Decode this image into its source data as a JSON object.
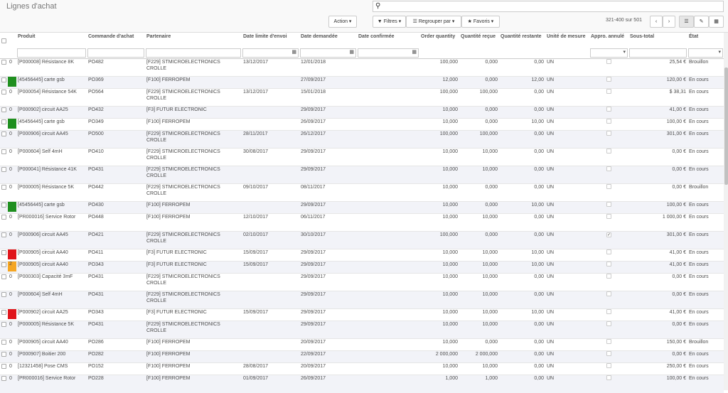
{
  "header": {
    "title": "Lignes d'achat",
    "search_value": ""
  },
  "toolbar": {
    "action": "Action ▾",
    "filters": "Filtres ▾",
    "group_by": "Regrouper par ▾",
    "favorites": "Favoris ▾"
  },
  "pager": {
    "text": "321-400 sur 501"
  },
  "columns": [
    "Produit",
    "Commande d'achat",
    "Partenaire",
    "Date limite d'envoi",
    "Date demandée",
    "Date confirmée",
    "Order quantity",
    "Quantité reçue",
    "Quantité restante",
    "Unité de mesure",
    "Appro. annulé",
    "Sous-total",
    "État"
  ],
  "colors": {
    "green": "#1f8f1f",
    "red": "#e0151b",
    "orange": "#f5a623"
  },
  "rows": [
    {
      "cnt": "0",
      "c": "",
      "p": "[P000008] Résistance 8K",
      "po": "PO482",
      "pa": "[F229] STMICROELECTRONICS CROLLE",
      "dl": "13/12/2017",
      "dd": "12/01/2018",
      "dc": "",
      "oq": "100,000",
      "qr": "0,000",
      "qrest": "0,00",
      "u": "UN",
      "a": false,
      "st": "25,54 €",
      "e": "Brouillon"
    },
    {
      "cnt": "",
      "c": "green",
      "p": "[45456445] carte gsb",
      "po": "PO369",
      "pa": "[F100] FERROPEM",
      "dl": "",
      "dd": "27/09/2017",
      "dc": "",
      "oq": "12,000",
      "qr": "0,000",
      "qrest": "12,00",
      "u": "UN",
      "a": false,
      "st": "120,00 €",
      "e": "En cours"
    },
    {
      "cnt": "0",
      "c": "",
      "p": "[P000054] Résistance 54K",
      "po": "PO564",
      "pa": "[F229] STMICROELECTRONICS CROLLE",
      "dl": "13/12/2017",
      "dd": "15/01/2018",
      "dc": "",
      "oq": "100,000",
      "qr": "100,000",
      "qrest": "0,00",
      "u": "UN",
      "a": false,
      "st": "$ 38,31",
      "e": "En cours"
    },
    {
      "cnt": "0",
      "c": "",
      "p": "[P000902] circuit AA25",
      "po": "PO432",
      "pa": "[F3] FUTUR ELECTRONIC",
      "dl": "",
      "dd": "29/09/2017",
      "dc": "",
      "oq": "10,000",
      "qr": "0,000",
      "qrest": "0,00",
      "u": "UN",
      "a": false,
      "st": "41,00 €",
      "e": "En cours"
    },
    {
      "cnt": "",
      "c": "green",
      "p": "[45456445] carte gsb",
      "po": "PO349",
      "pa": "[F100] FERROPEM",
      "dl": "",
      "dd": "26/09/2017",
      "dc": "",
      "oq": "10,000",
      "qr": "0,000",
      "qrest": "10,00",
      "u": "UN",
      "a": false,
      "st": "100,00 €",
      "e": "En cours"
    },
    {
      "cnt": "0",
      "c": "",
      "p": "[P000906] circuit AA45",
      "po": "PO500",
      "pa": "[F229] STMICROELECTRONICS CROLLE",
      "dl": "28/11/2017",
      "dd": "26/12/2017",
      "dc": "",
      "oq": "100,000",
      "qr": "100,000",
      "qrest": "0,00",
      "u": "UN",
      "a": false,
      "st": "301,00 €",
      "e": "En cours"
    },
    {
      "cnt": "0",
      "c": "",
      "p": "[P000604] Self 4mH",
      "po": "PO410",
      "pa": "[F229] STMICROELECTRONICS CROLLE",
      "dl": "30/08/2017",
      "dd": "29/09/2017",
      "dc": "",
      "oq": "10,000",
      "qr": "10,000",
      "qrest": "0,00",
      "u": "UN",
      "a": false,
      "st": "0,00 €",
      "e": "En cours"
    },
    {
      "cnt": "0",
      "c": "",
      "p": "[P000041] Résistance 41K",
      "po": "PO431",
      "pa": "[F229] STMICROELECTRONICS CROLLE",
      "dl": "",
      "dd": "29/09/2017",
      "dc": "",
      "oq": "10,000",
      "qr": "10,000",
      "qrest": "0,00",
      "u": "UN",
      "a": false,
      "st": "0,00 €",
      "e": "En cours"
    },
    {
      "cnt": "0",
      "c": "",
      "p": "[P000005] Résistance 5K",
      "po": "PO442",
      "pa": "[F229] STMICROELECTRONICS CROLLE",
      "dl": "09/10/2017",
      "dd": "08/11/2017",
      "dc": "",
      "oq": "10,000",
      "qr": "0,000",
      "qrest": "0,00",
      "u": "UN",
      "a": false,
      "st": "0,00 €",
      "e": "Brouillon"
    },
    {
      "cnt": "",
      "c": "green",
      "p": "[45456445] carte gsb",
      "po": "PO430",
      "pa": "[F100] FERROPEM",
      "dl": "",
      "dd": "29/09/2017",
      "dc": "",
      "oq": "10,000",
      "qr": "0,000",
      "qrest": "10,00",
      "u": "UN",
      "a": false,
      "st": "100,00 €",
      "e": "En cours"
    },
    {
      "cnt": "0",
      "c": "",
      "p": "[PR000016] Service Rotor",
      "po": "PO448",
      "pa": "[F100] FERROPEM",
      "dl": "12/10/2017",
      "dd": "06/11/2017",
      "dc": "",
      "oq": "10,000",
      "qr": "10,000",
      "qrest": "0,00",
      "u": "UN",
      "a": false,
      "st": "1 000,00 €",
      "e": "En cours"
    },
    {
      "cnt": "0",
      "c": "",
      "p": "[P000906] circuit AA45",
      "po": "PO421",
      "pa": "[F229] STMICROELECTRONICS CROLLE",
      "dl": "02/10/2017",
      "dd": "30/10/2017",
      "dc": "",
      "oq": "100,000",
      "qr": "0,000",
      "qrest": "0,00",
      "u": "UN",
      "a": true,
      "st": "301,00 €",
      "e": "En cours"
    },
    {
      "cnt": "",
      "c": "red",
      "p": "[P000905] circuit AA40",
      "po": "PO411",
      "pa": "[F3] FUTUR ELECTRONIC",
      "dl": "15/09/2017",
      "dd": "29/09/2017",
      "dc": "",
      "oq": "10,000",
      "qr": "10,000",
      "qrest": "10,00",
      "u": "UN",
      "a": false,
      "st": "41,00 €",
      "e": "En cours"
    },
    {
      "cnt": "2",
      "c": "orange",
      "p": "[P000905] circuit AA40",
      "po": "PO343",
      "pa": "[F3] FUTUR ELECTRONIC",
      "dl": "15/09/2017",
      "dd": "29/09/2017",
      "dc": "",
      "oq": "10,000",
      "qr": "10,000",
      "qrest": "10,00",
      "u": "UN",
      "a": false,
      "st": "41,00 €",
      "e": "En cours"
    },
    {
      "cnt": "0",
      "c": "",
      "p": "[P000303] Capacité 3mF",
      "po": "PO431",
      "pa": "[F229] STMICROELECTRONICS CROLLE",
      "dl": "",
      "dd": "29/09/2017",
      "dc": "",
      "oq": "10,000",
      "qr": "10,000",
      "qrest": "0,00",
      "u": "UN",
      "a": false,
      "st": "0,00 €",
      "e": "En cours"
    },
    {
      "cnt": "0",
      "c": "",
      "p": "[P000604] Self 4mH",
      "po": "PO431",
      "pa": "[F229] STMICROELECTRONICS CROLLE",
      "dl": "",
      "dd": "29/09/2017",
      "dc": "",
      "oq": "10,000",
      "qr": "10,000",
      "qrest": "0,00",
      "u": "UN",
      "a": false,
      "st": "0,00 €",
      "e": "En cours"
    },
    {
      "cnt": "",
      "c": "red",
      "p": "[P000902] circuit AA25",
      "po": "PO343",
      "pa": "[F3] FUTUR ELECTRONIC",
      "dl": "15/09/2017",
      "dd": "29/09/2017",
      "dc": "",
      "oq": "10,000",
      "qr": "10,000",
      "qrest": "10,00",
      "u": "UN",
      "a": false,
      "st": "41,00 €",
      "e": "En cours"
    },
    {
      "cnt": "0",
      "c": "",
      "p": "[P000005] Résistance 5K",
      "po": "PO431",
      "pa": "[F229] STMICROELECTRONICS CROLLE",
      "dl": "",
      "dd": "29/09/2017",
      "dc": "",
      "oq": "10,000",
      "qr": "10,000",
      "qrest": "0,00",
      "u": "UN",
      "a": false,
      "st": "0,00 €",
      "e": "En cours"
    },
    {
      "cnt": "0",
      "c": "",
      "p": "[P000905] circuit AA40",
      "po": "PO286",
      "pa": "[F100] FERROPEM",
      "dl": "",
      "dd": "20/09/2017",
      "dc": "",
      "oq": "10,000",
      "qr": "0,000",
      "qrest": "0,00",
      "u": "UN",
      "a": false,
      "st": "150,00 €",
      "e": "Brouillon"
    },
    {
      "cnt": "0",
      "c": "",
      "p": "[P000907] Boitier 200",
      "po": "PO282",
      "pa": "[F100] FERROPEM",
      "dl": "",
      "dd": "22/09/2017",
      "dc": "",
      "oq": "2 000,000",
      "qr": "2 000,000",
      "qrest": "0,00",
      "u": "UN",
      "a": false,
      "st": "0,00 €",
      "e": "En cours"
    },
    {
      "cnt": "0",
      "c": "",
      "p": "[12321458] Pose CMS",
      "po": "PO152",
      "pa": "[F100] FERROPEM",
      "dl": "28/08/2017",
      "dd": "20/09/2017",
      "dc": "",
      "oq": "10,000",
      "qr": "10,000",
      "qrest": "0,00",
      "u": "UN",
      "a": false,
      "st": "250,00 €",
      "e": "En cours"
    },
    {
      "cnt": "0",
      "c": "",
      "p": "[PR000016] Service Rotor",
      "po": "PO228",
      "pa": "[F100] FERROPEM",
      "dl": "01/09/2017",
      "dd": "26/09/2017",
      "dc": "",
      "oq": "1,000",
      "qr": "1,000",
      "qrest": "0,00",
      "u": "UN",
      "a": false,
      "st": "100,00 €",
      "e": "En cours"
    }
  ]
}
